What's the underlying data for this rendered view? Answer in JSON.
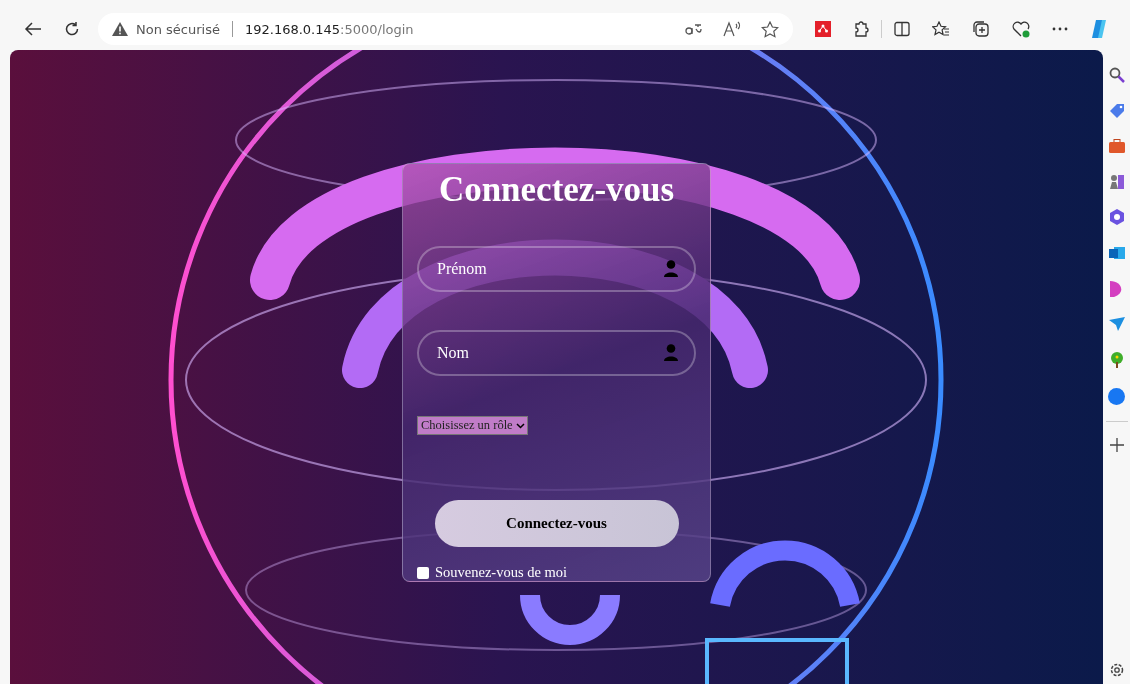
{
  "address_bar": {
    "security_label": "Non sécurisé",
    "url_host": "192.168.0.145",
    "url_rest": ":5000/login"
  },
  "login": {
    "title": "Connectez-vous",
    "fields": [
      {
        "placeholder": "Prénom"
      },
      {
        "placeholder": "Nom"
      }
    ],
    "role_select": {
      "value": "Choisissez un rôle"
    },
    "submit": "Connectez-vous",
    "remember": {
      "label": "Souvenez-vous de moi",
      "checked": false
    }
  }
}
